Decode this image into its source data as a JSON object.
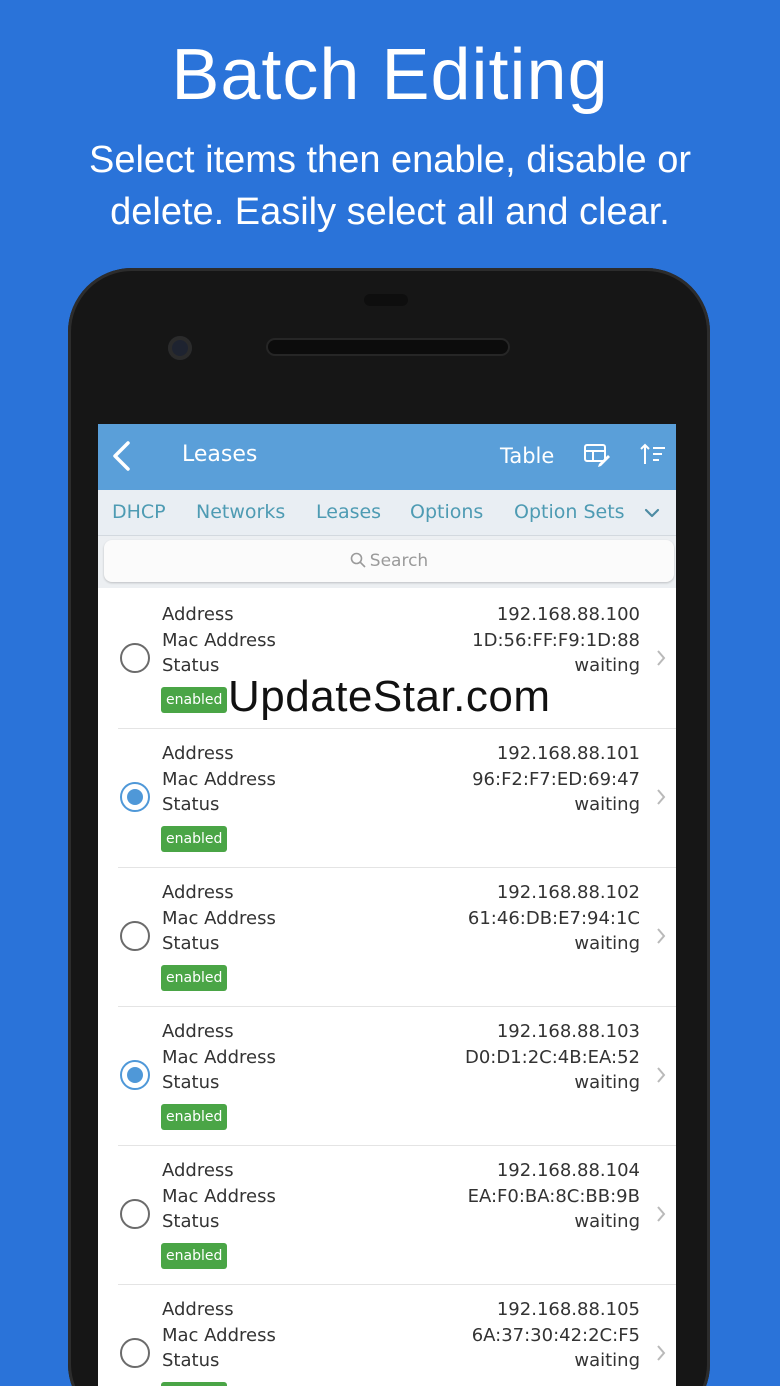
{
  "promo": {
    "headline": "Batch Editing",
    "subline": "Select items then enable, disable or delete. Easily select all and clear."
  },
  "navbar": {
    "back_label": "<",
    "title": "Leases",
    "table_label": "Table",
    "edit_icon": "edit-table-icon",
    "sort_icon": "sort-icon"
  },
  "tabs": [
    {
      "label": "DHCP"
    },
    {
      "label": "Networks"
    },
    {
      "label": "Leases"
    },
    {
      "label": "Options"
    },
    {
      "label": "Option Sets"
    }
  ],
  "tab_more_icon": "chevron-down-icon",
  "search": {
    "placeholder": "Search"
  },
  "field_labels": {
    "address": "Address",
    "mac": "Mac Address",
    "status": "Status"
  },
  "leases": [
    {
      "address": "192.168.88.100",
      "mac": "1D:56:FF:F9:1D:88",
      "status": "waiting",
      "badge": "enabled",
      "selected": false
    },
    {
      "address": "192.168.88.101",
      "mac": "96:F2:F7:ED:69:47",
      "status": "waiting",
      "badge": "enabled",
      "selected": true
    },
    {
      "address": "192.168.88.102",
      "mac": "61:46:DB:E7:94:1C",
      "status": "waiting",
      "badge": "enabled",
      "selected": false
    },
    {
      "address": "192.168.88.103",
      "mac": "D0:D1:2C:4B:EA:52",
      "status": "waiting",
      "badge": "enabled",
      "selected": true
    },
    {
      "address": "192.168.88.104",
      "mac": "EA:F0:BA:8C:BB:9B",
      "status": "waiting",
      "badge": "enabled",
      "selected": false
    },
    {
      "address": "192.168.88.105",
      "mac": "6A:37:30:42:2C:F5",
      "status": "waiting",
      "badge": "enabled",
      "selected": false
    }
  ],
  "watermark": "UpdateStar.com",
  "colors": {
    "background": "#2a73d9",
    "navbar": "#5a9fd9",
    "tab_text": "#4e9bb3",
    "badge": "#4aa546",
    "radio_selected": "#4f98d8"
  }
}
